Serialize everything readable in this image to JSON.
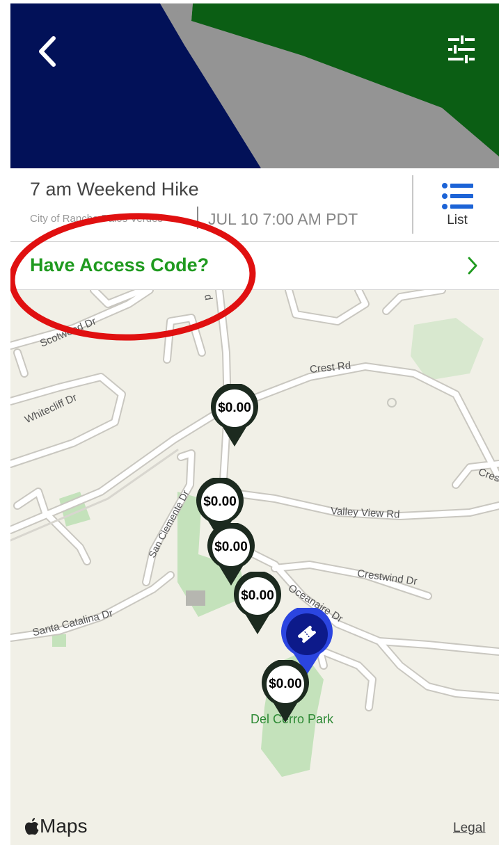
{
  "event": {
    "title": "7 am Weekend Hike",
    "venue": "City of Rancho Palos Verdes",
    "datetime": "JUL 10 7:00 AM PDT"
  },
  "list_button": {
    "label": "List"
  },
  "access_code": {
    "label": "Have Access Code?"
  },
  "map": {
    "streets": [
      "Scotwood Dr",
      "Whitecliff Dr",
      "Crest Rd",
      "Valley View Rd",
      "San Clemente Dr",
      "Crestwind Dr",
      "Oceanaire Dr",
      "Santa Catalina Dr",
      "Cres",
      "d"
    ],
    "park_label": "Del Cerro Park",
    "pins": [
      "$0.00",
      "$0.00",
      "$0.00",
      "$0.00",
      "$0.00"
    ],
    "attribution": "Maps",
    "legal": "Legal"
  },
  "colors": {
    "accent_green": "#1f9a1f",
    "pin_dark": "#1c2a1f",
    "location_blue": "#2b45e0",
    "annotation_red": "#e01010"
  }
}
